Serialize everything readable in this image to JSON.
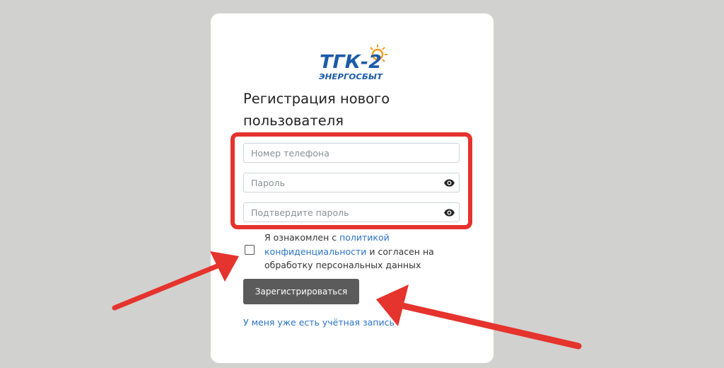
{
  "brand": {
    "logo_main": "ТГК-2",
    "logo_sub": "ЭНЕРГОСБЫТ",
    "logo_color": "#1c5ba8",
    "logo_sun_color": "#f39c1f"
  },
  "form": {
    "title": "Регистрация нового пользователя",
    "phone_placeholder": "Номер телефона",
    "password_placeholder": "Пароль",
    "confirm_placeholder": "Подтвердите пароль",
    "password_icon": "eye-icon",
    "consent_prefix": "Я ознакомлен с ",
    "consent_link": "политикой конфиденциальности",
    "consent_suffix": " и согласен на обработку персональных данных",
    "consent_checked": false,
    "submit_label": "Зарегистрироваться",
    "login_link": "У меня уже есть учётная запись"
  },
  "annotations": {
    "highlight_color": "#e5332d",
    "arrow_color": "#e5332d"
  }
}
